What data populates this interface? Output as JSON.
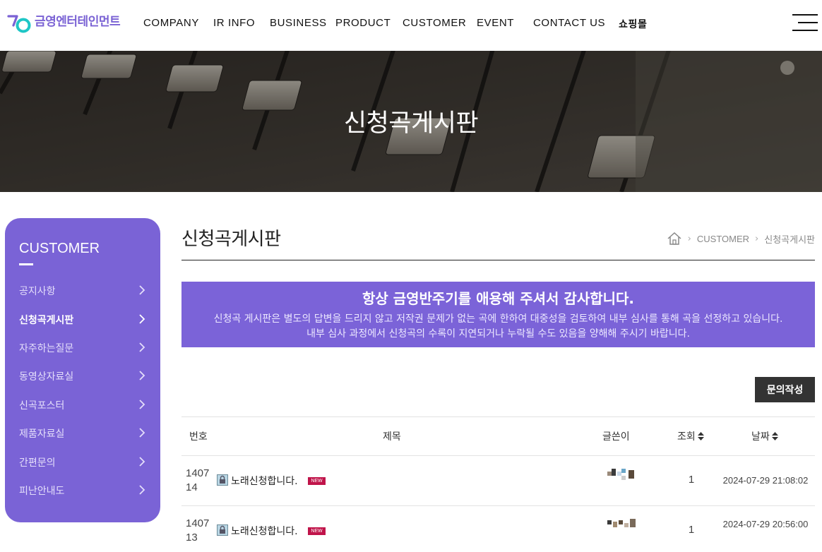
{
  "header": {
    "logo_text": "금영엔터테인먼트",
    "nav": [
      "COMPANY",
      "IR INFO",
      "BUSINESS",
      "PRODUCT",
      "CUSTOMER",
      "EVENT",
      "CONTACT US",
      "쇼핑몰"
    ],
    "menu_icon": "hamburger-icon"
  },
  "hero": {
    "title": "신청곡게시판"
  },
  "sidebar": {
    "title": "CUSTOMER",
    "items": [
      {
        "label": "공지사항"
      },
      {
        "label": "신청곡게시판"
      },
      {
        "label": "자주하는질문"
      },
      {
        "label": "동영상자료실"
      },
      {
        "label": "신곡포스터"
      },
      {
        "label": "제품자료실"
      },
      {
        "label": "간편문의"
      },
      {
        "label": "피난안내도"
      }
    ],
    "active_index": 1
  },
  "main": {
    "title": "신청곡게시판",
    "breadcrumb": {
      "home_icon": "home-icon",
      "items": [
        "CUSTOMER",
        "신청곡게시판"
      ]
    },
    "notice": {
      "headline": "항상 금영반주기를 애용해 주셔서 감사합니다.",
      "line1": "신청곡 게시판은 별도의 답변을 드리지 않고 저작권 문제가 없는 곡에 한하여 대중성을 검토하여 내부 심사를 통해 곡을 선정하고 있습니다.",
      "line2": "내부 심사 과정에서 신청곡의 수록이 지연되거나 누락될 수도 있음을 양해해 주시기 바랍니다."
    },
    "write_button": "문의작성",
    "table": {
      "headers": {
        "number": "번호",
        "subject": "제목",
        "author": "글쓴이",
        "views": "조회",
        "date": "날짜"
      },
      "rows": [
        {
          "number": "140714",
          "subject": "노래신청합니다.",
          "badge": "NEW",
          "views": "1",
          "date": "2024-07-29 21:08:02"
        },
        {
          "number": "140713",
          "subject": "노래신청합니다.",
          "badge": "NEW",
          "views": "1",
          "date": "2024-07-29 20:56:00"
        }
      ]
    }
  },
  "colors": {
    "accent": "#7a63d6",
    "badge": "#c0144a",
    "button": "#333333"
  }
}
